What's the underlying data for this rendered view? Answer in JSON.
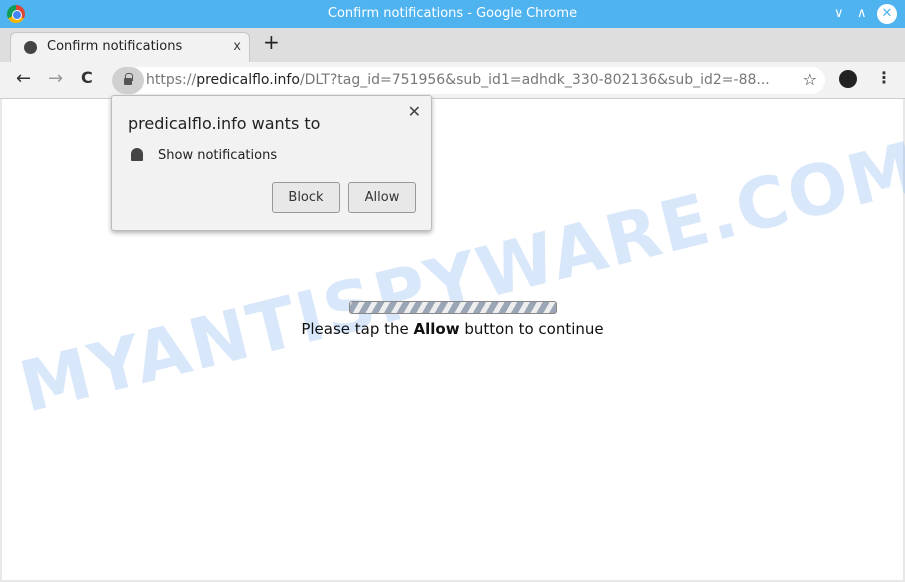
{
  "window": {
    "title": "Confirm notifications - Google Chrome",
    "min": "∨",
    "max": "∧",
    "close": "✕"
  },
  "tab": {
    "label": "Confirm notifications",
    "close": "x",
    "new_tab": "+"
  },
  "toolbar": {
    "back": "←",
    "forward": "→",
    "reload": "C",
    "url_scheme": "https://",
    "url_host": "predicalflo.info",
    "url_path": "/DLT?tag_id=751956&sub_id1=adhdk_330-802136&sub_id2=-88...",
    "star": "☆",
    "menu": "⋮"
  },
  "popup": {
    "title": "predicalflo.info wants to",
    "permission": "Show notifications",
    "block": "Block",
    "allow": "Allow",
    "close": "✕"
  },
  "page": {
    "progress_percent": 100,
    "msg_before": "Please tap the ",
    "msg_bold": "Allow",
    "msg_after": " button to continue",
    "watermark": "MYANTISPYWARE.COM"
  }
}
